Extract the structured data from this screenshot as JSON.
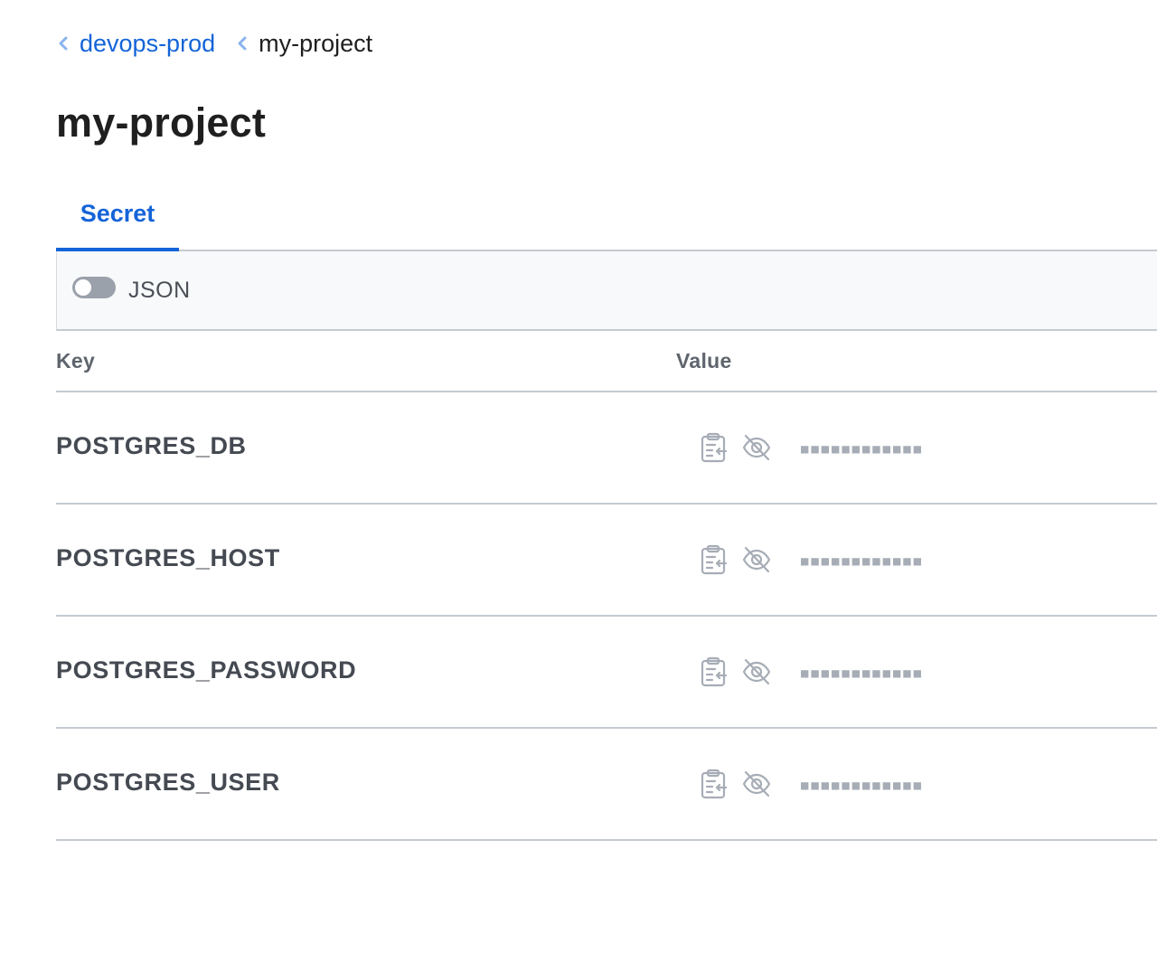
{
  "breadcrumb": {
    "items": [
      {
        "label": "devops-prod",
        "link": true
      },
      {
        "label": "my-project",
        "link": false
      }
    ]
  },
  "page": {
    "title": "my-project"
  },
  "tabs": [
    {
      "label": "Secret",
      "active": true
    }
  ],
  "toolbar": {
    "json_toggle_label": "JSON",
    "json_toggle_on": false
  },
  "table": {
    "headers": {
      "key": "Key",
      "value": "Value"
    },
    "rows": [
      {
        "key": "POSTGRES_DB",
        "masked_value": "■■■■■■■■■■■■"
      },
      {
        "key": "POSTGRES_HOST",
        "masked_value": "■■■■■■■■■■■■"
      },
      {
        "key": "POSTGRES_PASSWORD",
        "masked_value": "■■■■■■■■■■■■"
      },
      {
        "key": "POSTGRES_USER",
        "masked_value": "■■■■■■■■■■■■"
      }
    ]
  },
  "icons": {
    "row_actions": [
      "clipboard-copy-icon",
      "eye-off-icon"
    ],
    "breadcrumb_separator": "chevron-left-icon"
  },
  "colors": {
    "accent": "#1464d8",
    "text": "#1f1f1f",
    "muted": "#5f656d",
    "divider": "#c5cad1",
    "toggle_off": "#9aa1ab",
    "mask": "#a7adb6"
  }
}
